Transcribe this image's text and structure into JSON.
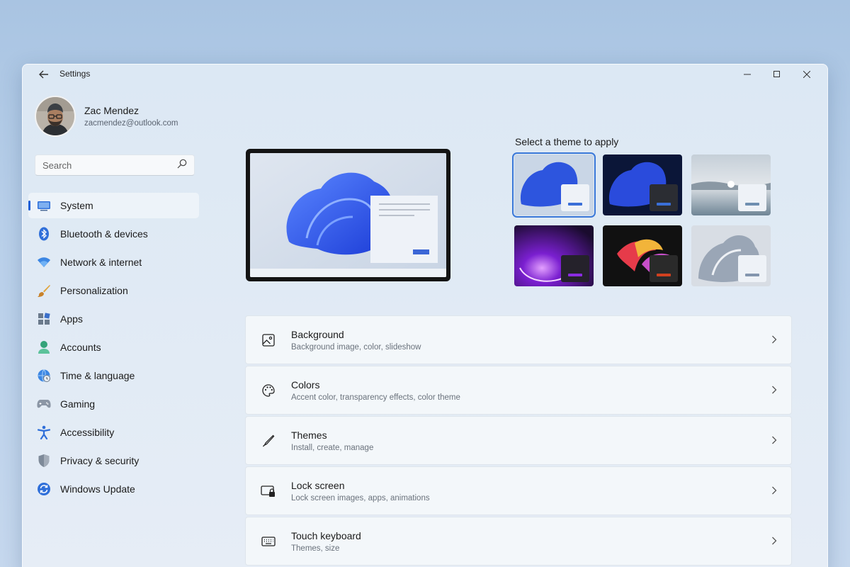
{
  "window": {
    "title": "Settings"
  },
  "profile": {
    "name": "Zac Mendez",
    "email": "zacmendez@outlook.com"
  },
  "search": {
    "placeholder": "Search"
  },
  "sidebar": {
    "items": [
      {
        "label": "System",
        "icon": "system-icon",
        "active": true
      },
      {
        "label": "Bluetooth & devices",
        "icon": "bluetooth-icon"
      },
      {
        "label": "Network & internet",
        "icon": "wifi-icon"
      },
      {
        "label": "Personalization",
        "icon": "paintbrush-icon"
      },
      {
        "label": "Apps",
        "icon": "apps-icon"
      },
      {
        "label": "Accounts",
        "icon": "accounts-icon"
      },
      {
        "label": "Time & language",
        "icon": "globe-clock-icon"
      },
      {
        "label": "Gaming",
        "icon": "gamepad-icon"
      },
      {
        "label": "Accessibility",
        "icon": "accessibility-icon"
      },
      {
        "label": "Privacy & security",
        "icon": "shield-icon"
      },
      {
        "label": "Windows Update",
        "icon": "update-icon"
      }
    ]
  },
  "themes": {
    "heading": "Select a theme to apply",
    "selected_index": 0,
    "tiles": [
      {
        "name": "windows-light",
        "accent": "#3a6fd8"
      },
      {
        "name": "windows-dark",
        "accent": "#3a6fd8"
      },
      {
        "name": "glow-lake",
        "accent": "#6f8fb0"
      },
      {
        "name": "captured-motion",
        "accent": "#8a2be2"
      },
      {
        "name": "flow",
        "accent": "#d0401f"
      },
      {
        "name": "sunrise-bloom",
        "accent": "#8496ae"
      }
    ]
  },
  "cards": [
    {
      "title": "Background",
      "subtitle": "Background image, color, slideshow",
      "icon": "image-icon"
    },
    {
      "title": "Colors",
      "subtitle": "Accent color, transparency effects, color theme",
      "icon": "palette-icon"
    },
    {
      "title": "Themes",
      "subtitle": "Install, create, manage",
      "icon": "pen-icon"
    },
    {
      "title": "Lock screen",
      "subtitle": "Lock screen images, apps, animations",
      "icon": "lock-screen-icon"
    },
    {
      "title": "Touch keyboard",
      "subtitle": "Themes, size",
      "icon": "keyboard-icon"
    }
  ],
  "colors": {
    "accent": "#1d5fd6",
    "window_bg": "#dfe9f4"
  }
}
